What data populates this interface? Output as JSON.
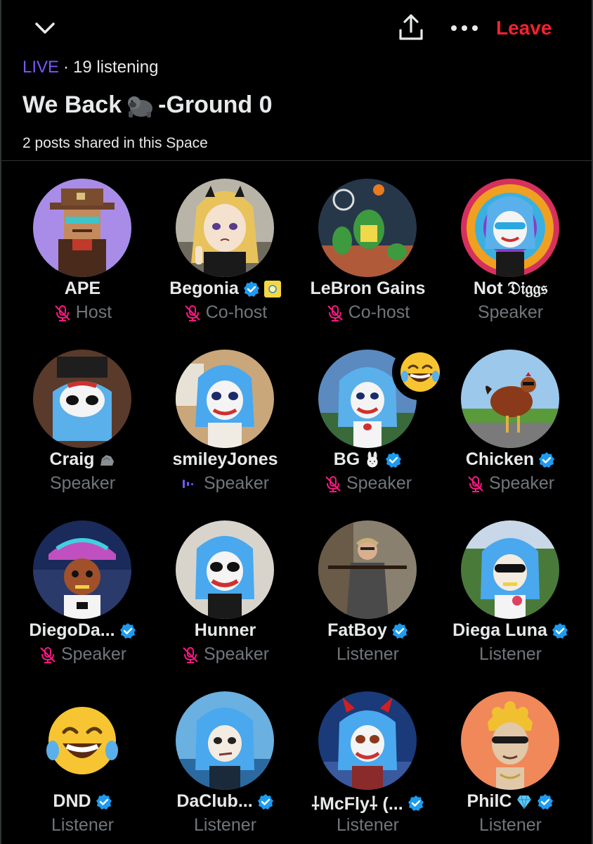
{
  "header": {
    "leave_label": "Leave",
    "icons": {
      "collapse": "chevron-down-icon",
      "share": "share-icon",
      "more": "more-icon"
    }
  },
  "space": {
    "live_label": "LIVE",
    "separator": "·",
    "listening": "19 listening",
    "title_part1": "We Back",
    "title_emoji": "gorilla-emoji",
    "title_part2": "-Ground 0",
    "shared_posts": "2 posts shared in this Space"
  },
  "colors": {
    "background": "#000000",
    "live": "#7856ff",
    "leave": "#f4212e",
    "muted_mic": "#f91880",
    "verified": "#1d9bf0",
    "secondary_text": "#71767b",
    "primary_text": "#e7e9ea"
  },
  "participants": [
    {
      "name": "APE",
      "role": "Host",
      "verified": false,
      "mic": "muted",
      "badge": "",
      "avatar": "pixel-cowboy"
    },
    {
      "name": "Begonia",
      "role": "Co-host",
      "verified": true,
      "mic": "muted",
      "badge": "sun-badge",
      "avatar": "anime-girl"
    },
    {
      "name": "LeBron Gains",
      "role": "Co-host",
      "verified": false,
      "mic": "muted",
      "badge": "",
      "avatar": "basketball-frog"
    },
    {
      "name": "Not 𝔇𝔦𝔤𝔤𝔰",
      "role": "Speaker",
      "verified": false,
      "mic": "none",
      "badge": "",
      "avatar": "tie-dye-clown"
    },
    {
      "name": "Craig",
      "role": "Speaker",
      "verified": false,
      "mic": "none",
      "badge": "rock-emoji",
      "avatar": "masked-clown"
    },
    {
      "name": "smileyJones",
      "role": "Speaker",
      "verified": false,
      "mic": "speaking",
      "badge": "",
      "avatar": "clown-blue-hair"
    },
    {
      "name": "BG",
      "role": "Speaker",
      "verified": true,
      "mic": "muted",
      "badge": "rabbit-emoji",
      "avatar": "bunny-clown",
      "reaction": "laughing-emoji"
    },
    {
      "name": "Chicken",
      "role": "Speaker",
      "verified": true,
      "mic": "muted",
      "badge": "",
      "avatar": "chicken"
    },
    {
      "name": "DiegoDa...",
      "role": "Speaker",
      "verified": true,
      "mic": "muted",
      "badge": "",
      "avatar": "bucket-hat"
    },
    {
      "name": "Hunner",
      "role": "Speaker",
      "verified": false,
      "mic": "muted",
      "badge": "",
      "avatar": "clown-shades"
    },
    {
      "name": "FatBoy",
      "role": "Listener",
      "verified": true,
      "mic": "none",
      "badge": "",
      "avatar": "man-rifle"
    },
    {
      "name": "Diega Luna",
      "role": "Listener",
      "verified": true,
      "mic": "none",
      "badge": "",
      "avatar": "blue-hair-sunglasses"
    },
    {
      "name": "DND",
      "role": "Listener",
      "verified": true,
      "mic": "none",
      "badge": "",
      "avatar": "laughing-emoji"
    },
    {
      "name": "DaClub...",
      "role": "Listener",
      "verified": true,
      "mic": "none",
      "badge": "",
      "avatar": "blue-hair-beach"
    },
    {
      "name": "⸸McFly⸸ (...",
      "role": "Listener",
      "verified": true,
      "mic": "none",
      "badge": "",
      "avatar": "devil-clown"
    },
    {
      "name": "PhilC",
      "role": "Listener",
      "verified": true,
      "mic": "none",
      "badge": "diamond-emoji",
      "avatar": "gold-hair-cartoon"
    }
  ]
}
